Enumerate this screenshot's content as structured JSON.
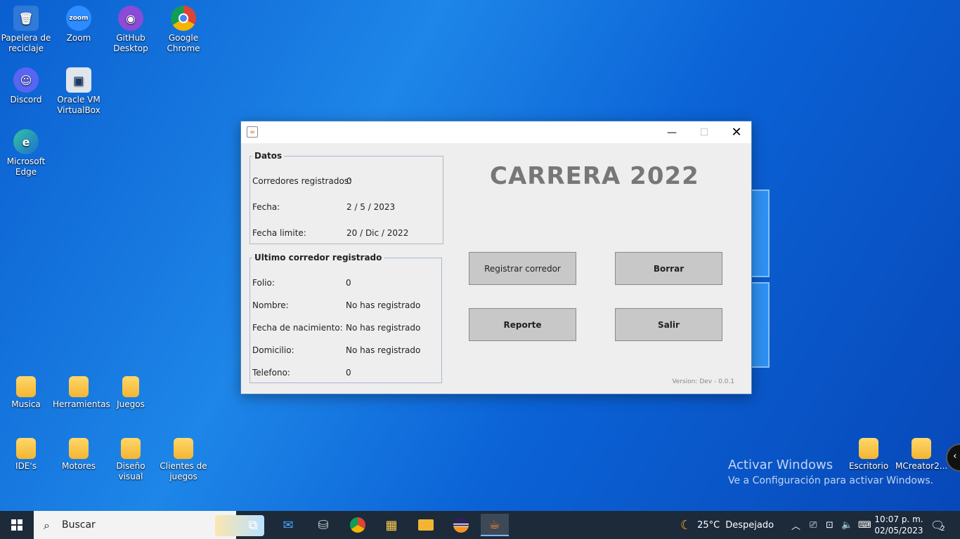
{
  "desktop": {
    "icons": [
      {
        "name": "recycle-bin",
        "label": "Papelera de reciclaje"
      },
      {
        "name": "zoom",
        "label": "Zoom"
      },
      {
        "name": "github-desktop",
        "label": "GitHub Desktop"
      },
      {
        "name": "google-chrome",
        "label": "Google Chrome"
      },
      {
        "name": "discord",
        "label": "Discord"
      },
      {
        "name": "virtualbox",
        "label": "Oracle VM VirtualBox"
      },
      {
        "name": "microsoft-edge",
        "label": "Microsoft Edge"
      },
      {
        "name": "musica",
        "label": "Musica"
      },
      {
        "name": "herramientas",
        "label": "Herramientas"
      },
      {
        "name": "juegos",
        "label": "Juegos"
      },
      {
        "name": "ides",
        "label": "IDE's"
      },
      {
        "name": "motores",
        "label": "Motores"
      },
      {
        "name": "diseno-visual",
        "label": "Diseño visual"
      },
      {
        "name": "clientes-juegos",
        "label": "Clientes de juegos"
      },
      {
        "name": "escritorio",
        "label": "Escritorio"
      },
      {
        "name": "mcreator",
        "label": "MCreator2..."
      }
    ],
    "activation": {
      "title": "Activar Windows",
      "subtitle": "Ve a Configuración para activar Windows."
    }
  },
  "window": {
    "title": "",
    "datos": {
      "legend": "Datos",
      "rows": [
        {
          "label": "Corredores registrados:",
          "value": "0"
        },
        {
          "label": "Fecha:",
          "value": "2 / 5 / 2023"
        },
        {
          "label": "Fecha limite:",
          "value": "20 / Dic / 2022"
        }
      ]
    },
    "ultimo": {
      "legend": "Ultimo corredor registrado",
      "rows": [
        {
          "label": "Folio:",
          "value": "0"
        },
        {
          "label": "Nombre:",
          "value": "No has registrado"
        },
        {
          "label": "Fecha de nacimiento:",
          "value": "No has registrado"
        },
        {
          "label": "Domicilio:",
          "value": "No has registrado"
        },
        {
          "label": "Telefono:",
          "value": "0"
        }
      ]
    },
    "heading": "CARRERA 2022",
    "buttons": {
      "registrar": "Registrar corredor",
      "borrar": "Borrar",
      "reporte": "Reporte",
      "salir": "Salir"
    },
    "version": "Version: Dev - 0.0.1"
  },
  "taskbar": {
    "search_placeholder": "Buscar",
    "weather_temp": "25°C",
    "weather_text": "Despejado",
    "time": "10:07 p. m.",
    "date": "02/05/2023",
    "notifications": "2"
  }
}
